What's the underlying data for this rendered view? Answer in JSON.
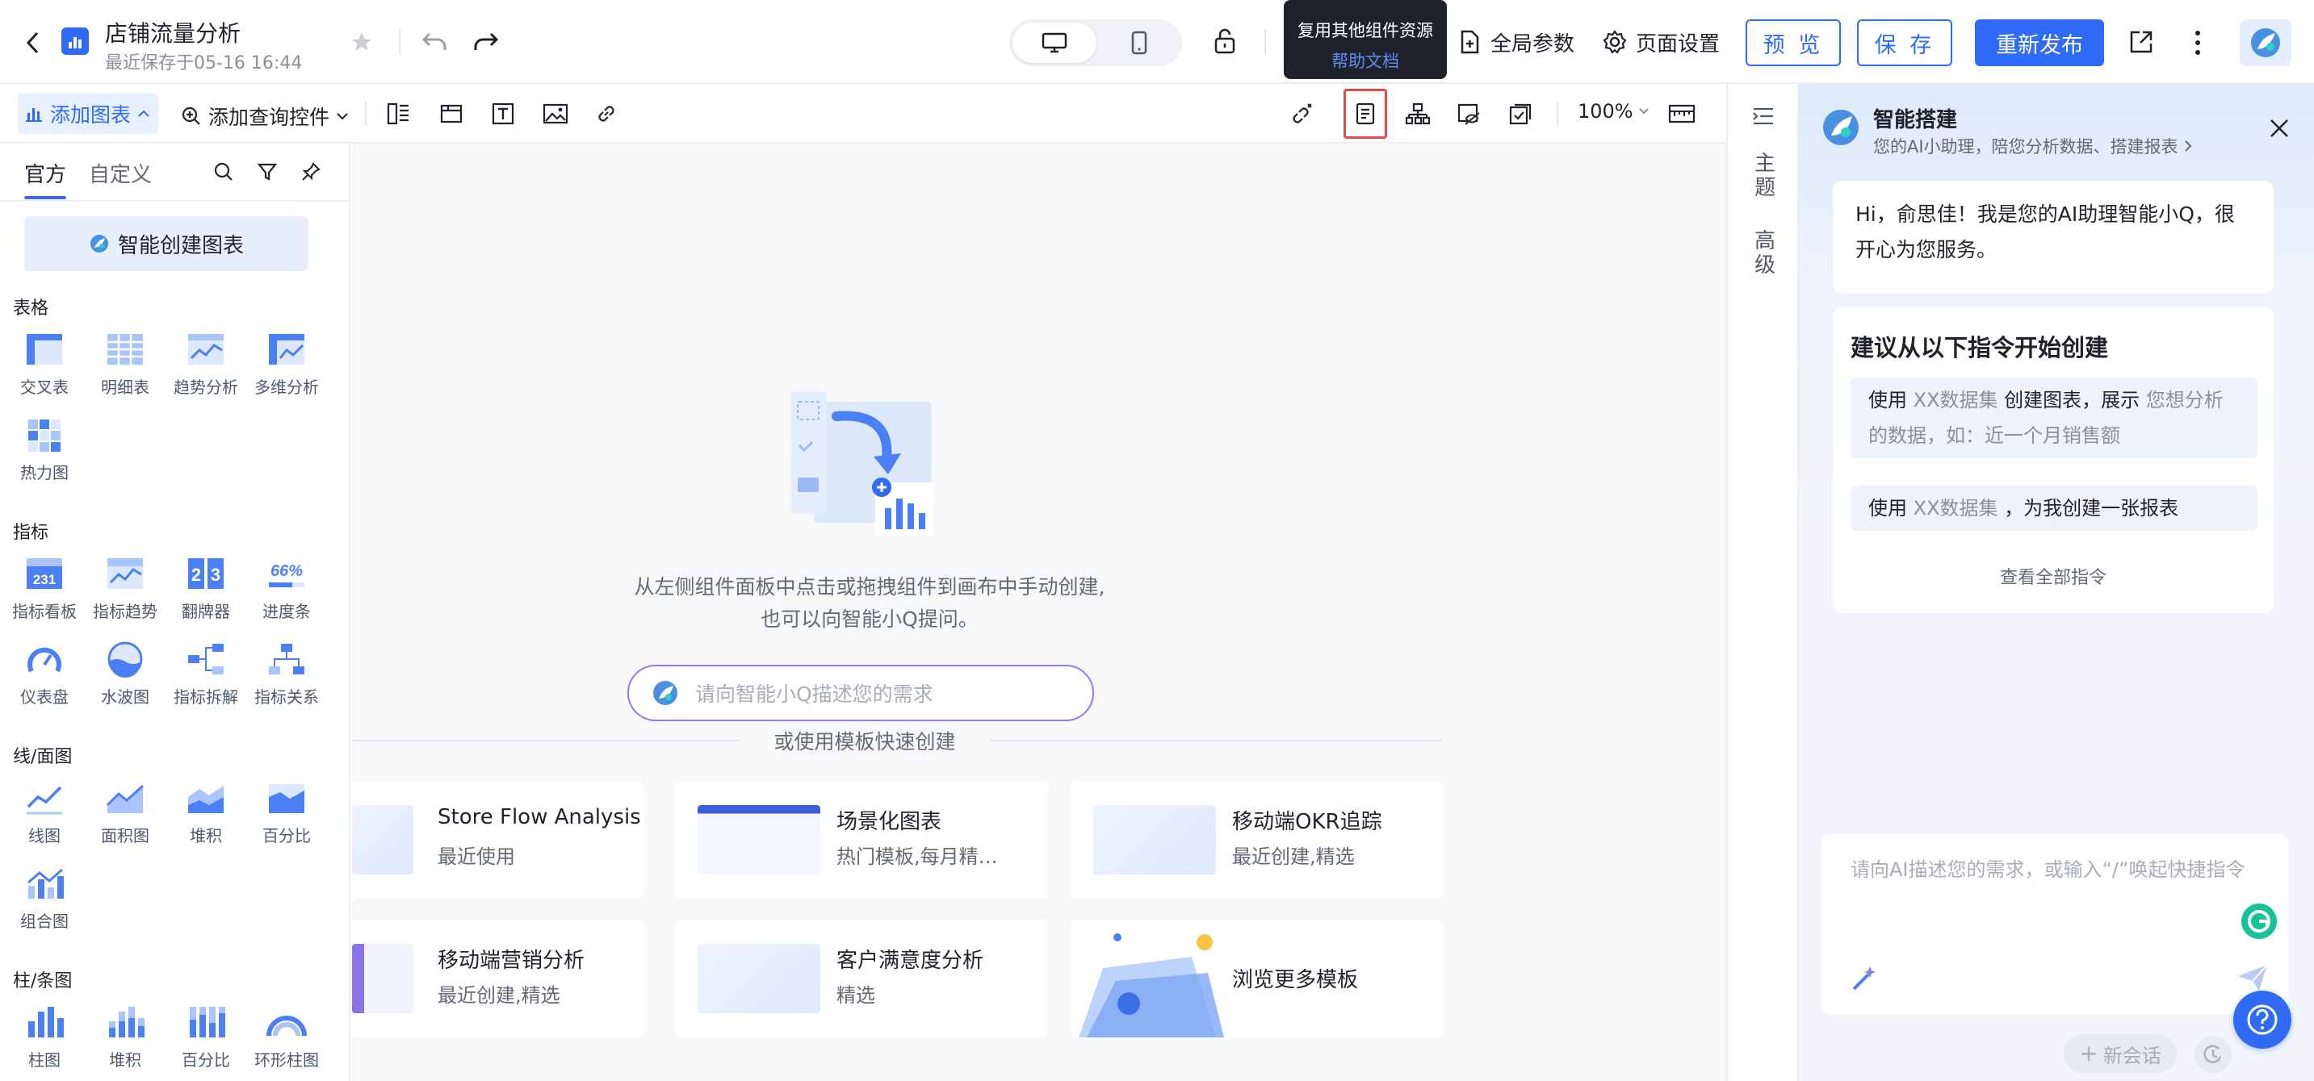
{
  "header": {
    "title": "店铺流量分析",
    "saved_at": "最近保存于05-16 16:44",
    "global_params": "全局参数",
    "page_settings": "页面设置",
    "preview": "预 览",
    "save": "保 存",
    "republish": "重新发布"
  },
  "tooltip": {
    "title": "复用其他组件资源",
    "link": "帮助文档"
  },
  "toolbar": {
    "add_chart": "添加图表",
    "add_query": "添加查询控件",
    "zoom": "100%"
  },
  "left_panel": {
    "tabs": [
      "官方",
      "自定义"
    ],
    "ai_create": "智能创建图表",
    "sections": {
      "table": {
        "title": "表格",
        "items": [
          "交叉表",
          "明细表",
          "趋势分析",
          "多维分析",
          "热力图"
        ]
      },
      "metric": {
        "title": "指标",
        "items": [
          "指标看板",
          "指标趋势",
          "翻牌器",
          "进度条",
          "仪表盘",
          "水波图",
          "指标拆解",
          "指标关系"
        ]
      },
      "line": {
        "title": "线/面图",
        "items": [
          "线图",
          "面积图",
          "堆积",
          "百分比",
          "组合图"
        ]
      },
      "bar": {
        "title": "柱/条图",
        "items": [
          "柱图",
          "堆积",
          "百分比",
          "环形柱图"
        ]
      }
    },
    "icon_texts": {
      "metric_board": "231",
      "flip_left": "2",
      "flip_right": "3",
      "progress": "66%"
    }
  },
  "canvas": {
    "empty_line1": "从左侧组件面板中点击或拖拽组件到画布中手动创建,",
    "empty_line2": "也可以向智能小Q提问。",
    "ask_placeholder": "请向智能小Q描述您的需求",
    "template_title": "或使用模板快速创建",
    "templates": [
      {
        "title": "Store Flow Analysis",
        "sub": "最近使用"
      },
      {
        "title": "场景化图表",
        "sub": "热门模板,每月精…"
      },
      {
        "title": "移动端OKR追踪",
        "sub": "最近创建,精选"
      },
      {
        "title": "移动端营销分析",
        "sub": "最近创建,精选"
      },
      {
        "title": "客户满意度分析",
        "sub": "精选"
      },
      {
        "title": "浏览更多模板",
        "sub": ""
      }
    ]
  },
  "right_strip": {
    "theme": "主题",
    "advanced": "高级"
  },
  "ai_panel": {
    "title": "智能搭建",
    "subtitle": "您的AI小助理，陪您分析数据、搭建报表",
    "greeting": "Hi，俞思佳！我是您的AI助理智能小Q，很开心为您服务。",
    "suggest_title": "建议从以下指令开始创建",
    "s1_a": "使用 ",
    "s1_b": "XX数据集",
    "s1_c": " 创建图表，展示 ",
    "s1_d": "您想分析的数据，如：近一个月销售额",
    "s2_a": "使用 ",
    "s2_b": "XX数据集",
    "s2_c": " ，为我创建一张报表",
    "view_all": "查看全部指令",
    "input_placeholder": "请向AI描述您的需求，或输入“/”唤起快捷指令",
    "new_chat": "新会话"
  },
  "colors": {
    "primary": "#2f6bf6",
    "tooltip_bg": "#1f2329",
    "highlight": "#e5484d"
  }
}
